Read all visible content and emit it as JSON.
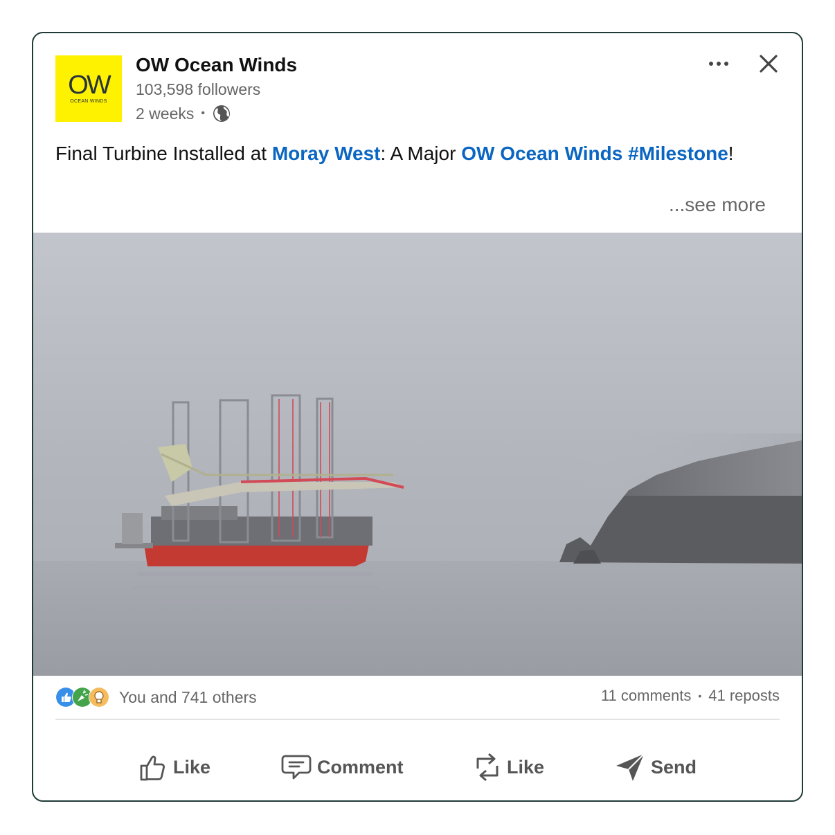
{
  "post": {
    "company_name": "OW Ocean Winds",
    "logo_text": "OW",
    "logo_subtext": "OCEAN WINDS",
    "followers": "103,598 followers",
    "time_ago": "2 weeks",
    "separator": "•",
    "text": {
      "part1": "Final Turbine Installed at ",
      "link1": "Moray West",
      "part2": ": A Major ",
      "link2": "OW Ocean Winds #Milestone",
      "part3": "!"
    },
    "see_more": "...see more"
  },
  "social": {
    "reactions_text": "You and 741 others",
    "comments": "11 comments",
    "reposts": "41 reposts",
    "separator": "•"
  },
  "actions": {
    "like": "Like",
    "comment": "Comment",
    "repost": "Like",
    "send": "Send"
  },
  "colors": {
    "link": "#0a66c2",
    "logo_bg": "#fff200",
    "border": "#1f3b36"
  },
  "icons": {
    "more": "more-horizontal-icon",
    "close": "close-icon",
    "globe": "globe-icon",
    "like": "thumbs-up-icon",
    "comment": "comment-icon",
    "repost": "repost-icon",
    "send": "send-icon"
  }
}
